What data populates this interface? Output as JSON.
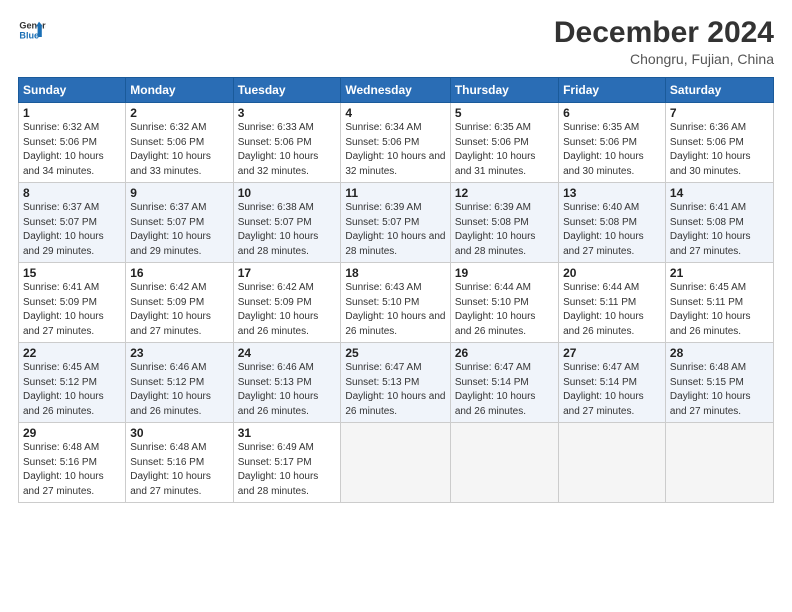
{
  "header": {
    "title": "December 2024",
    "subtitle": "Chongru, Fujian, China"
  },
  "calendar": {
    "columns": [
      "Sunday",
      "Monday",
      "Tuesday",
      "Wednesday",
      "Thursday",
      "Friday",
      "Saturday"
    ],
    "weeks": [
      [
        null,
        null,
        null,
        null,
        null,
        null,
        {
          "day": 7,
          "sunrise": "6:36 AM",
          "sunset": "5:06 PM",
          "daylight": "10 hours and 30 minutes."
        }
      ],
      [
        {
          "day": 1,
          "sunrise": "6:32 AM",
          "sunset": "5:06 PM",
          "daylight": "10 hours and 34 minutes."
        },
        {
          "day": 2,
          "sunrise": "6:32 AM",
          "sunset": "5:06 PM",
          "daylight": "10 hours and 33 minutes."
        },
        {
          "day": 3,
          "sunrise": "6:33 AM",
          "sunset": "5:06 PM",
          "daylight": "10 hours and 32 minutes."
        },
        {
          "day": 4,
          "sunrise": "6:34 AM",
          "sunset": "5:06 PM",
          "daylight": "10 hours and 32 minutes."
        },
        {
          "day": 5,
          "sunrise": "6:35 AM",
          "sunset": "5:06 PM",
          "daylight": "10 hours and 31 minutes."
        },
        {
          "day": 6,
          "sunrise": "6:35 AM",
          "sunset": "5:06 PM",
          "daylight": "10 hours and 30 minutes."
        },
        {
          "day": 7,
          "sunrise": "6:36 AM",
          "sunset": "5:06 PM",
          "daylight": "10 hours and 30 minutes."
        }
      ],
      [
        {
          "day": 8,
          "sunrise": "6:37 AM",
          "sunset": "5:07 PM",
          "daylight": "10 hours and 29 minutes."
        },
        {
          "day": 9,
          "sunrise": "6:37 AM",
          "sunset": "5:07 PM",
          "daylight": "10 hours and 29 minutes."
        },
        {
          "day": 10,
          "sunrise": "6:38 AM",
          "sunset": "5:07 PM",
          "daylight": "10 hours and 28 minutes."
        },
        {
          "day": 11,
          "sunrise": "6:39 AM",
          "sunset": "5:07 PM",
          "daylight": "10 hours and 28 minutes."
        },
        {
          "day": 12,
          "sunrise": "6:39 AM",
          "sunset": "5:08 PM",
          "daylight": "10 hours and 28 minutes."
        },
        {
          "day": 13,
          "sunrise": "6:40 AM",
          "sunset": "5:08 PM",
          "daylight": "10 hours and 27 minutes."
        },
        {
          "day": 14,
          "sunrise": "6:41 AM",
          "sunset": "5:08 PM",
          "daylight": "10 hours and 27 minutes."
        }
      ],
      [
        {
          "day": 15,
          "sunrise": "6:41 AM",
          "sunset": "5:09 PM",
          "daylight": "10 hours and 27 minutes."
        },
        {
          "day": 16,
          "sunrise": "6:42 AM",
          "sunset": "5:09 PM",
          "daylight": "10 hours and 27 minutes."
        },
        {
          "day": 17,
          "sunrise": "6:42 AM",
          "sunset": "5:09 PM",
          "daylight": "10 hours and 26 minutes."
        },
        {
          "day": 18,
          "sunrise": "6:43 AM",
          "sunset": "5:10 PM",
          "daylight": "10 hours and 26 minutes."
        },
        {
          "day": 19,
          "sunrise": "6:44 AM",
          "sunset": "5:10 PM",
          "daylight": "10 hours and 26 minutes."
        },
        {
          "day": 20,
          "sunrise": "6:44 AM",
          "sunset": "5:11 PM",
          "daylight": "10 hours and 26 minutes."
        },
        {
          "day": 21,
          "sunrise": "6:45 AM",
          "sunset": "5:11 PM",
          "daylight": "10 hours and 26 minutes."
        }
      ],
      [
        {
          "day": 22,
          "sunrise": "6:45 AM",
          "sunset": "5:12 PM",
          "daylight": "10 hours and 26 minutes."
        },
        {
          "day": 23,
          "sunrise": "6:46 AM",
          "sunset": "5:12 PM",
          "daylight": "10 hours and 26 minutes."
        },
        {
          "day": 24,
          "sunrise": "6:46 AM",
          "sunset": "5:13 PM",
          "daylight": "10 hours and 26 minutes."
        },
        {
          "day": 25,
          "sunrise": "6:47 AM",
          "sunset": "5:13 PM",
          "daylight": "10 hours and 26 minutes."
        },
        {
          "day": 26,
          "sunrise": "6:47 AM",
          "sunset": "5:14 PM",
          "daylight": "10 hours and 26 minutes."
        },
        {
          "day": 27,
          "sunrise": "6:47 AM",
          "sunset": "5:14 PM",
          "daylight": "10 hours and 27 minutes."
        },
        {
          "day": 28,
          "sunrise": "6:48 AM",
          "sunset": "5:15 PM",
          "daylight": "10 hours and 27 minutes."
        }
      ],
      [
        {
          "day": 29,
          "sunrise": "6:48 AM",
          "sunset": "5:16 PM",
          "daylight": "10 hours and 27 minutes."
        },
        {
          "day": 30,
          "sunrise": "6:48 AM",
          "sunset": "5:16 PM",
          "daylight": "10 hours and 27 minutes."
        },
        {
          "day": 31,
          "sunrise": "6:49 AM",
          "sunset": "5:17 PM",
          "daylight": "10 hours and 28 minutes."
        },
        null,
        null,
        null,
        null
      ]
    ]
  }
}
